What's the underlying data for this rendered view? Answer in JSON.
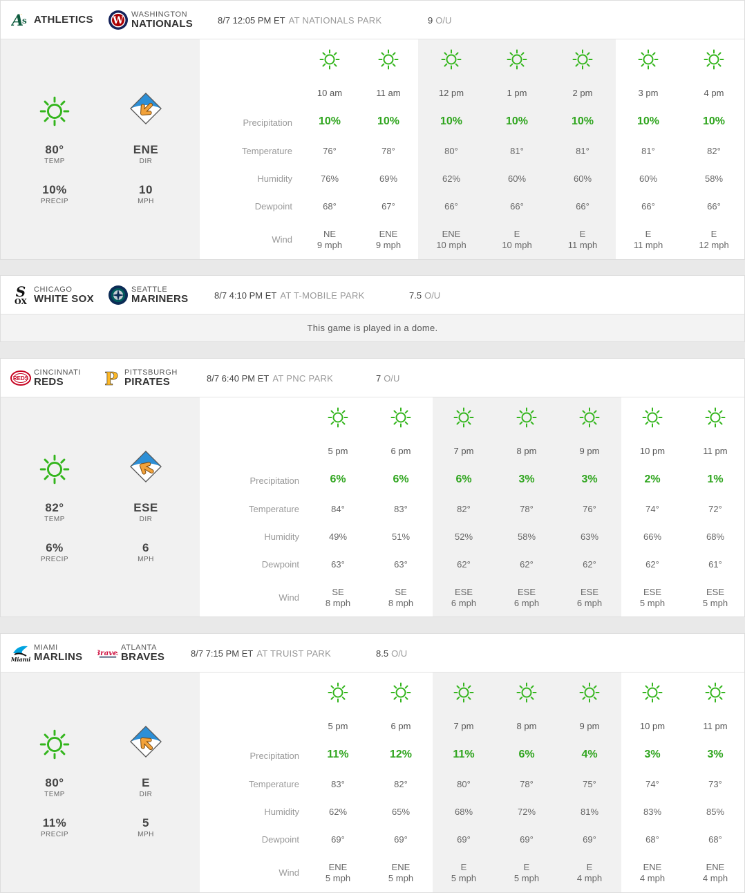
{
  "colors": {
    "sun": "#33b51c",
    "precip": "#2fa51e",
    "compass_top": "#2d8fd6",
    "arrow": "#f2a23a",
    "shade": "#f1f1f1"
  },
  "labels": {
    "precipitation": "Precipitation",
    "temperature": "Temperature",
    "humidity": "Humidity",
    "dewpoint": "Dewpoint",
    "wind": "Wind",
    "temp": "TEMP",
    "precip": "PRECIP",
    "dir": "DIR",
    "mph": "MPH",
    "ou": "O/U"
  },
  "games": [
    {
      "away": {
        "city": "",
        "name": "ATHLETICS",
        "logo": "athletics-logo"
      },
      "home": {
        "city": "WASHINGTON",
        "name": "NATIONALS",
        "logo": "nationals-logo"
      },
      "datetime": "8/7 12:05 PM ET",
      "venue": "AT NATIONALS PARK",
      "ou": "9",
      "summary": {
        "temp": "80°",
        "precip": "10%",
        "dir": "ENE",
        "mph": "10"
      },
      "hours": [
        {
          "time": "10 am",
          "precip": "10%",
          "temp": "76°",
          "humidity": "76%",
          "dew": "68°",
          "wind_dir": "NE",
          "wind_speed": "9 mph"
        },
        {
          "time": "11 am",
          "precip": "10%",
          "temp": "78°",
          "humidity": "69%",
          "dew": "67°",
          "wind_dir": "ENE",
          "wind_speed": "9 mph"
        },
        {
          "time": "12 pm",
          "precip": "10%",
          "temp": "80°",
          "humidity": "62%",
          "dew": "66°",
          "wind_dir": "ENE",
          "wind_speed": "10 mph"
        },
        {
          "time": "1 pm",
          "precip": "10%",
          "temp": "81°",
          "humidity": "60%",
          "dew": "66°",
          "wind_dir": "E",
          "wind_speed": "10 mph"
        },
        {
          "time": "2 pm",
          "precip": "10%",
          "temp": "81°",
          "humidity": "60%",
          "dew": "66°",
          "wind_dir": "E",
          "wind_speed": "11 mph"
        },
        {
          "time": "3 pm",
          "precip": "10%",
          "temp": "81°",
          "humidity": "60%",
          "dew": "66°",
          "wind_dir": "E",
          "wind_speed": "11 mph"
        },
        {
          "time": "4 pm",
          "precip": "10%",
          "temp": "82°",
          "humidity": "58%",
          "dew": "66°",
          "wind_dir": "E",
          "wind_speed": "12 mph"
        }
      ]
    },
    {
      "away": {
        "city": "CHICAGO",
        "name": "WHITE SOX",
        "logo": "white-sox-logo"
      },
      "home": {
        "city": "SEATTLE",
        "name": "MARINERS",
        "logo": "mariners-logo"
      },
      "datetime": "8/7 4:10 PM ET",
      "venue": "AT T-MOBILE PARK",
      "ou": "7.5",
      "dome_text": "This game is played in a dome."
    },
    {
      "away": {
        "city": "CINCINNATI",
        "name": "REDS",
        "logo": "reds-logo"
      },
      "home": {
        "city": "PITTSBURGH",
        "name": "PIRATES",
        "logo": "pirates-logo"
      },
      "datetime": "8/7 6:40 PM ET",
      "venue": "AT PNC PARK",
      "ou": "7",
      "summary": {
        "temp": "82°",
        "precip": "6%",
        "dir": "ESE",
        "mph": "6"
      },
      "hours": [
        {
          "time": "5 pm",
          "precip": "6%",
          "temp": "84°",
          "humidity": "49%",
          "dew": "63°",
          "wind_dir": "SE",
          "wind_speed": "8 mph"
        },
        {
          "time": "6 pm",
          "precip": "6%",
          "temp": "83°",
          "humidity": "51%",
          "dew": "63°",
          "wind_dir": "SE",
          "wind_speed": "8 mph"
        },
        {
          "time": "7 pm",
          "precip": "6%",
          "temp": "82°",
          "humidity": "52%",
          "dew": "62°",
          "wind_dir": "ESE",
          "wind_speed": "6 mph"
        },
        {
          "time": "8 pm",
          "precip": "3%",
          "temp": "78°",
          "humidity": "58%",
          "dew": "62°",
          "wind_dir": "ESE",
          "wind_speed": "6 mph"
        },
        {
          "time": "9 pm",
          "precip": "3%",
          "temp": "76°",
          "humidity": "63%",
          "dew": "62°",
          "wind_dir": "ESE",
          "wind_speed": "6 mph"
        },
        {
          "time": "10 pm",
          "precip": "2%",
          "temp": "74°",
          "humidity": "66%",
          "dew": "62°",
          "wind_dir": "ESE",
          "wind_speed": "5 mph"
        },
        {
          "time": "11 pm",
          "precip": "1%",
          "temp": "72°",
          "humidity": "68%",
          "dew": "61°",
          "wind_dir": "ESE",
          "wind_speed": "5 mph"
        }
      ]
    },
    {
      "away": {
        "city": "MIAMI",
        "name": "MARLINS",
        "logo": "marlins-logo"
      },
      "home": {
        "city": "ATLANTA",
        "name": "BRAVES",
        "logo": "braves-logo"
      },
      "datetime": "8/7 7:15 PM ET",
      "venue": "AT TRUIST PARK",
      "ou": "8.5",
      "summary": {
        "temp": "80°",
        "precip": "11%",
        "dir": "E",
        "mph": "5"
      },
      "hours": [
        {
          "time": "5 pm",
          "precip": "11%",
          "temp": "83°",
          "humidity": "62%",
          "dew": "69°",
          "wind_dir": "ENE",
          "wind_speed": "5 mph"
        },
        {
          "time": "6 pm",
          "precip": "12%",
          "temp": "82°",
          "humidity": "65%",
          "dew": "69°",
          "wind_dir": "ENE",
          "wind_speed": "5 mph"
        },
        {
          "time": "7 pm",
          "precip": "11%",
          "temp": "80°",
          "humidity": "68%",
          "dew": "69°",
          "wind_dir": "E",
          "wind_speed": "5 mph"
        },
        {
          "time": "8 pm",
          "precip": "6%",
          "temp": "78°",
          "humidity": "72%",
          "dew": "69°",
          "wind_dir": "E",
          "wind_speed": "5 mph"
        },
        {
          "time": "9 pm",
          "precip": "4%",
          "temp": "75°",
          "humidity": "81%",
          "dew": "69°",
          "wind_dir": "E",
          "wind_speed": "4 mph"
        },
        {
          "time": "10 pm",
          "precip": "3%",
          "temp": "74°",
          "humidity": "83%",
          "dew": "68°",
          "wind_dir": "ENE",
          "wind_speed": "4 mph"
        },
        {
          "time": "11 pm",
          "precip": "3%",
          "temp": "73°",
          "humidity": "85%",
          "dew": "68°",
          "wind_dir": "ENE",
          "wind_speed": "4 mph"
        }
      ]
    }
  ]
}
